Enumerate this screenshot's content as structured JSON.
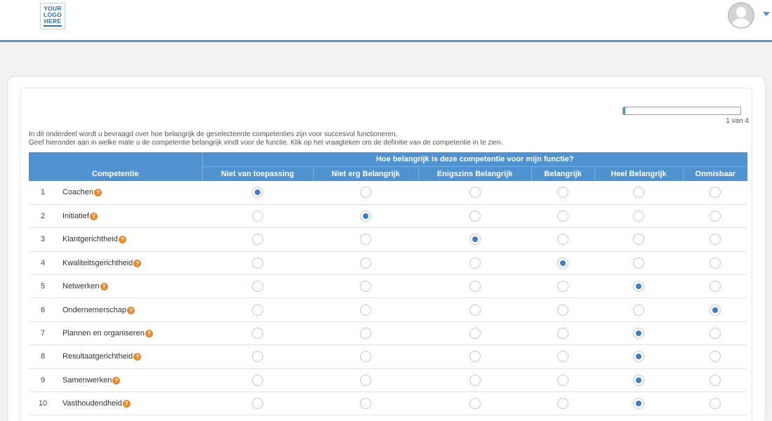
{
  "header": {
    "logo_lines": [
      "YOUR",
      "LOGO",
      "HERE"
    ]
  },
  "progress": {
    "label": "1 van 4",
    "value": 0.02
  },
  "intro": {
    "line1": "In dit onderdeel wordt u bevraagd over hoe belangrijk de geselecteerde competenties zijn voor succesvol functioneren.",
    "line2": "Geef hieronder aan in welke mate u de competentie belangrijk vindt voor de functie. Klik op het vraagteken om de definitie van de competentie in te zien."
  },
  "table": {
    "competency_header": "Competentie",
    "group_header": "Hoe belangrijk is deze competentie voor mijn functie?",
    "help_icon": "?",
    "options": [
      "Niet van toepassing",
      "Niet erg Belangrijk",
      "Enigszins Belangrijk",
      "Belangrijk",
      "Heel Belangrijk",
      "Onmisbaar"
    ],
    "rows": [
      {
        "num": "1",
        "name": "Coachen",
        "selected": 0
      },
      {
        "num": "2",
        "name": "Initiatief",
        "selected": 1
      },
      {
        "num": "3",
        "name": "Klantgerichtheid",
        "selected": 2
      },
      {
        "num": "4",
        "name": "Kwaliteitsgerichtheid",
        "selected": 3
      },
      {
        "num": "5",
        "name": "Netwerken",
        "selected": 4
      },
      {
        "num": "6",
        "name": "Ondernemerschap",
        "selected": 5
      },
      {
        "num": "7",
        "name": "Plannen en organiseren",
        "selected": 4
      },
      {
        "num": "8",
        "name": "Resultaatgerichtheid",
        "selected": 4
      },
      {
        "num": "9",
        "name": "Samenwerken",
        "selected": 4
      },
      {
        "num": "10",
        "name": "Vasthoudendheid",
        "selected": 4
      }
    ]
  },
  "colors": {
    "accent": "#4f92cf",
    "help": "#e08a32",
    "radio_checked": "#3f7fbf"
  }
}
